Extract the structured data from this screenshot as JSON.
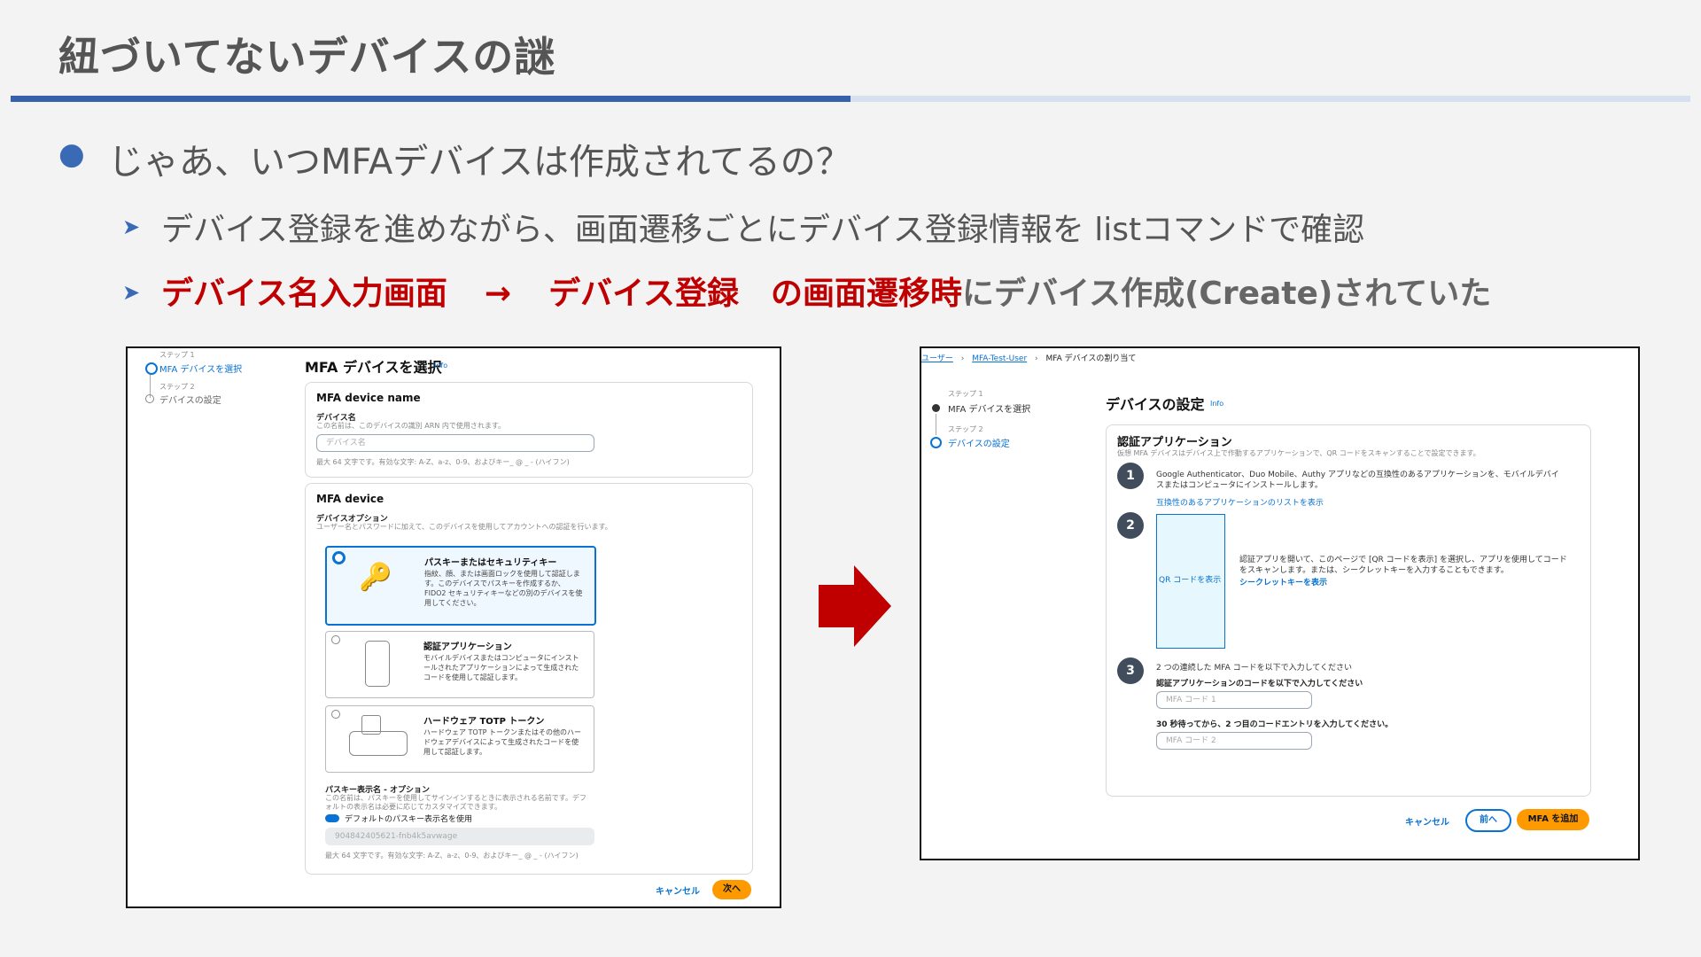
{
  "slide": {
    "title": "紐づいてないデバイスの謎",
    "bullet1": "じゃあ、いつMFAデバイスは作成されてるの？",
    "sub1": "デバイス登録を進めながら、画面遷移ごとにデバイス登録情報を listコマンドで確認",
    "sub2_red1": "デバイス名入力画面",
    "sub2_arrow": "→",
    "sub2_red2": "デバイス登録",
    "sub2_red3": "の画面遷移時",
    "sub2_rest": "にデバイス作成(Create)されていた",
    "colors": {
      "accent": "#3461a9",
      "red": "#c00000",
      "arrow": "#c00000"
    }
  },
  "left": {
    "steps": [
      {
        "small": "ステップ 1",
        "label": "MFA デバイスを選択"
      },
      {
        "small": "ステップ 2",
        "label": "デバイスの設定"
      }
    ],
    "page_title": "MFA デバイスを選択",
    "info": "Info",
    "name_card": {
      "header": "MFA device name",
      "field_label": "デバイス名",
      "field_desc": "この名前は、このデバイスの識別 ARN 内で使用されます。",
      "placeholder": "デバイス名",
      "constraint": "最大 64 文字です。有効な文字: A-Z、a-z、0-9、およびキー_ @ _ - (ハイフン)"
    },
    "device_card": {
      "header": "MFA device",
      "opt_label": "デバイスオプション",
      "opt_desc": "ユーザー名とパスワードに加えて、このデバイスを使用してアカウントへの認証を行います。",
      "options": [
        {
          "title": "パスキーまたはセキュリティキー",
          "desc": "指紋、顔、または画面ロックを使用して認証します。このデバイスでパスキーを作成するか、FIDO2 セキュリティキーなどの別のデバイスを使用してください。"
        },
        {
          "title": "認証アプリケーション",
          "desc": "モバイルデバイスまたはコンピュータにインストールされたアプリケーションによって生成されたコードを使用して認証します。"
        },
        {
          "title": "ハードウェア TOTP トークン",
          "desc": "ハードウェア TOTP トークンまたはその他のハードウェアデバイスによって生成されたコードを使用して認証します。"
        }
      ],
      "passkey_label": "パスキー表示名 - オプション",
      "passkey_desc": "この名前は、パスキーを使用してサインインするときに表示される名前です。デフォルトの表示名は必要に応じてカスタマイズできます。",
      "toggle_label": "デフォルトのパスキー表示名を使用",
      "disabled_value": "904842405621-fnb4k5avwage",
      "constraint": "最大 64 文字です。有効な文字: A-Z、a-z、0-9、およびキー_ @ _ - (ハイフン)"
    },
    "cancel": "キャンセル",
    "next": "次へ"
  },
  "right": {
    "breadcrumb": [
      "ユーザー",
      "MFA-Test-User",
      "MFA デバイスの割り当て"
    ],
    "steps": [
      {
        "small": "ステップ 1",
        "label": "MFA デバイスを選択"
      },
      {
        "small": "ステップ 2",
        "label": "デバイスの設定"
      }
    ],
    "page_title": "デバイスの設定",
    "info": "Info",
    "card_title": "認証アプリケーション",
    "card_desc": "仮想 MFA デバイスはデバイス上で作動するアプリケーションで、QR コードをスキャンすることで設定できます。",
    "step1_text": "Google Authenticator、Duo Mobile、Authy アプリなどの互換性のあるアプリケーションを、モバイルデバイスまたはコンピュータにインストールします。",
    "step1_link": "互換性のあるアプリケーションのリストを表示",
    "qr_label": "QR コードを表示",
    "step2_text": "認証アプリを開いて、このページで [QR コードを表示] を選択し、アプリを使用してコードをスキャンします。または、シークレットキーを入力することもできます。",
    "step2_link": "シークレットキーを表示",
    "step3_text": "2 つの連続した MFA コードを以下で入力してください",
    "code1_label": "認証アプリケーションのコードを以下で入力してください",
    "code1_placeholder": "MFA コード 1",
    "code2_label": "30 秒待ってから、2 つ目のコードエントリを入力してください。",
    "code2_placeholder": "MFA コード 2",
    "cancel": "キャンセル",
    "prev": "前へ",
    "add": "MFA を追加"
  }
}
